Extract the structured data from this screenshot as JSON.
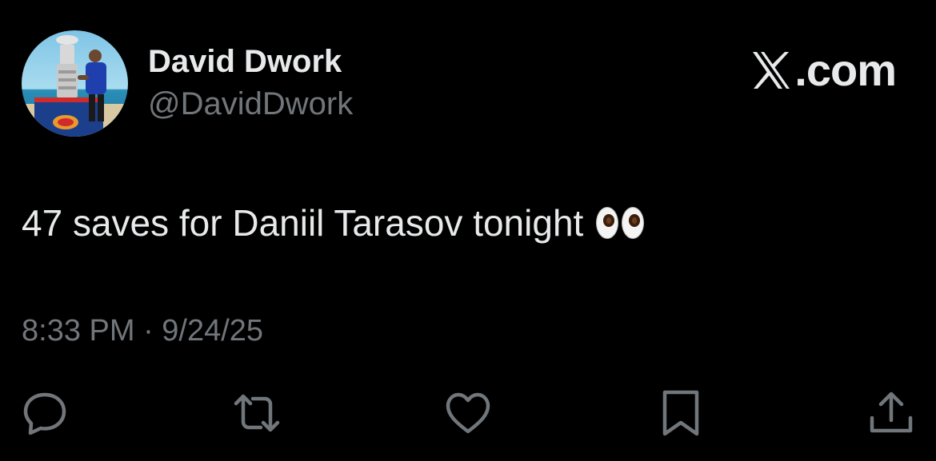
{
  "author": {
    "display_name": "David Dwork",
    "handle": "@DavidDwork",
    "avatar_icon": "avatar-photo-stanley-cup"
  },
  "brand": {
    "icon": "x-logo-icon",
    "text": ".com"
  },
  "tweet": {
    "text": "47 saves for Daniil Tarasov tonight",
    "emoji_icon": "eyes-emoji-icon",
    "timestamp": "8:33 PM · 9/24/25"
  },
  "actions": [
    {
      "name": "reply",
      "icon": "speech-bubble-icon"
    },
    {
      "name": "repost",
      "icon": "repost-arrows-icon"
    },
    {
      "name": "like",
      "icon": "heart-icon"
    },
    {
      "name": "bookmark",
      "icon": "bookmark-icon"
    },
    {
      "name": "share",
      "icon": "share-upload-icon"
    }
  ],
  "colors": {
    "background": "#000000",
    "primary_text": "#e7e9ea",
    "secondary_text": "#71767b"
  }
}
